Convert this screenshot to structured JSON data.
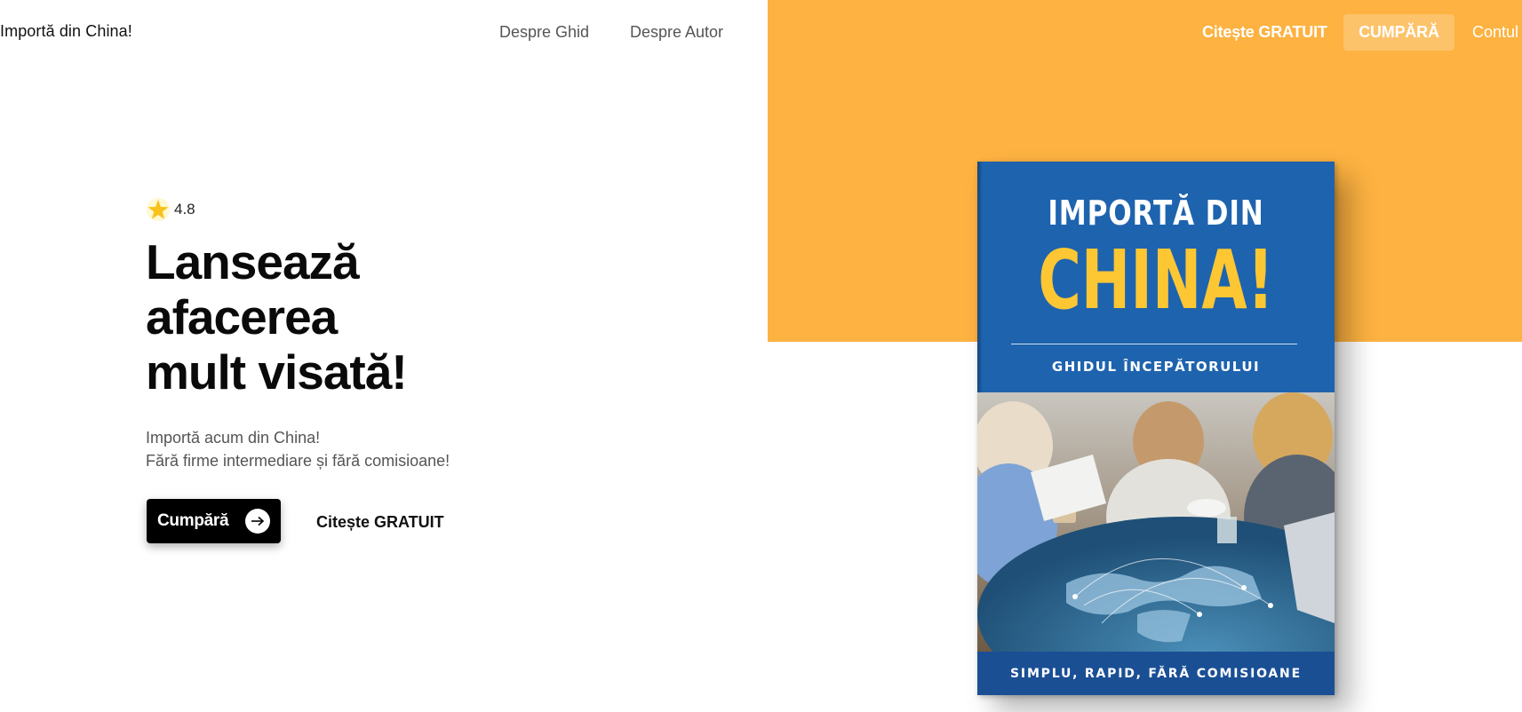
{
  "header": {
    "brand": "Importă din China!",
    "nav_left": [
      "Despre Ghid",
      "Despre Autor"
    ],
    "read_free": "Citește GRATUIT",
    "buy": "CUMPĂRĂ",
    "account": "Contul"
  },
  "hero": {
    "rating": "4.8",
    "headline_lines": [
      "Lansează",
      "afacerea",
      "mult visată!"
    ],
    "subtext_lines": [
      "Importă acum din China!",
      "Fără firme intermediare și fără comisioane!"
    ],
    "cta_buy": "Cumpără",
    "cta_read": "Citește GRATUIT"
  },
  "book": {
    "title_line1": "IMPORTĂ DIN",
    "title_line2": "CHINA!",
    "subtitle": "GHIDUL ÎNCEPĂTORULUI",
    "footer": "SIMPLU, RAPID, FĂRĂ COMISIOANE"
  },
  "colors": {
    "accent_orange": "#FDB241",
    "book_blue": "#1E63AE",
    "book_yellow": "#FDC733",
    "cta_black": "#000000"
  },
  "icons": {
    "rating": "star-icon",
    "cta_arrow": "arrow-right-icon"
  }
}
